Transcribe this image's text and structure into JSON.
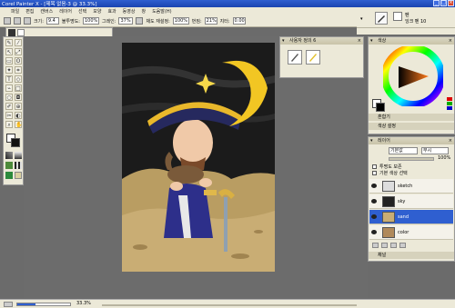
{
  "titlebar": {
    "title": "Corel Painter X - [제목 없음-3 @ 33.3%]",
    "min": "_",
    "max": "□",
    "close": "×"
  },
  "menubar": {
    "items": [
      "파일",
      "편집",
      "캔버스",
      "레이어",
      "선택",
      "모양",
      "효과",
      "동영상",
      "창",
      "도움말(H)"
    ]
  },
  "propbar": {
    "size_label": "크기:",
    "size_value": "9.4",
    "opacity_label": "불투명도:",
    "opacity_value": "100%",
    "grain_label": "그레인:",
    "grain_value": "37%",
    "resat_label": "채도 재설정:",
    "resat_value": "100%",
    "bleed_label": "번짐:",
    "bleed_value": "21%",
    "jitter_label": "지터:",
    "jitter_value": "0.00"
  },
  "rightbar": {
    "label1": "펜",
    "label2": "잉크 펜 10"
  },
  "custom_palette": {
    "title": "사용자 정의 6"
  },
  "color_panel": {
    "title": "색상",
    "mixer_label": "혼합기",
    "sets_label": "색상 설정"
  },
  "layers_panel": {
    "title": "레이어",
    "blend_mode": "기본값",
    "composite": "무시",
    "opacity": "100%",
    "preserve_label": "투명도 보존",
    "pick_label": "기본 색상 선택",
    "layers": [
      "sketch",
      "sky",
      "sand",
      "color"
    ],
    "channels_label": "채널"
  },
  "statusbar": {
    "zoom": "33.3%"
  },
  "colors": {
    "accent": "#2f5fd0",
    "panel": "#ece9d8",
    "canvas_bg": "#6c6c6c"
  }
}
